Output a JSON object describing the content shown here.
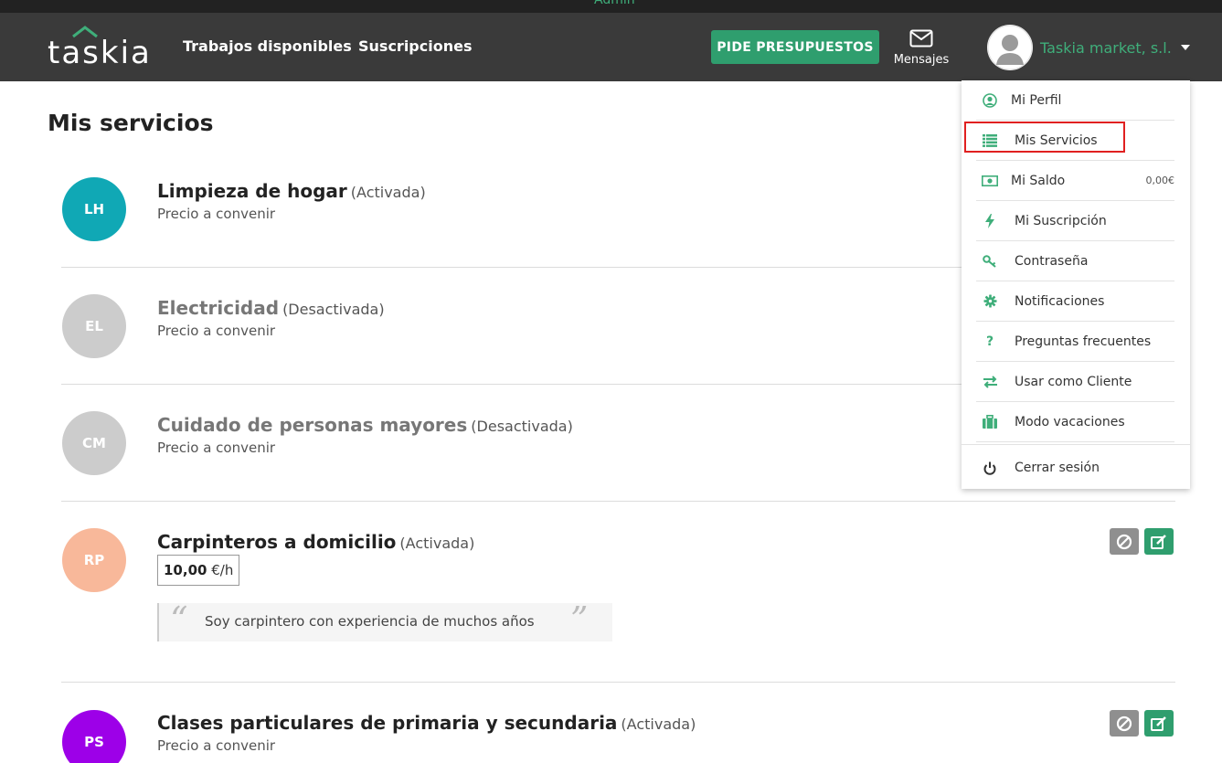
{
  "topbar": {
    "label": "Admin"
  },
  "brand": {
    "logo_text": "taskia",
    "accent": "#3fae7a"
  },
  "nav": {
    "links": [
      "Trabajos disponibles",
      "Suscripciones"
    ],
    "cta": "PIDE PRESUPUESTOS",
    "messages_label": "Mensajes",
    "user_name": "Taskia market, s.l."
  },
  "page": {
    "title": "Mis servicios"
  },
  "services": [
    {
      "initials": "LH",
      "title": "Limpieza de hogar",
      "status": "(Activada)",
      "price": "Precio a convenir",
      "color": "#10a8b5"
    },
    {
      "initials": "EL",
      "title": "Electricidad",
      "status": "(Desactivada)",
      "price": "Precio a convenir",
      "color": "#cccccc"
    },
    {
      "initials": "CM",
      "title": "Cuidado de personas mayores",
      "status": "(Desactivada)",
      "price": "Precio a convenir",
      "color": "#cccccc"
    },
    {
      "initials": "RP",
      "title": "Carpinteros a domicilio",
      "status": "(Activada)",
      "price_amount": "10,00",
      "price_unit": "€/h",
      "description": "Soy carpintero con experiencia de muchos años",
      "color": "#f8b89a"
    },
    {
      "initials": "PS",
      "title": "Clases particulares de primaria y secundaria",
      "status": "(Activada)",
      "price": "Precio a convenir",
      "color": "#9d00e8"
    }
  ],
  "menu": {
    "items": [
      {
        "label": "Mi Perfil",
        "icon": "user-circle-icon"
      },
      {
        "label": "Mis Servicios",
        "icon": "list-icon"
      },
      {
        "label": "Mi Saldo",
        "icon": "money-icon",
        "amount": "0,00€"
      },
      {
        "label": "Mi Suscripción",
        "icon": "bolt-icon"
      },
      {
        "label": "Contraseña",
        "icon": "key-icon"
      },
      {
        "label": "Notificaciones",
        "icon": "gear-icon"
      },
      {
        "label": "Preguntas frecuentes",
        "icon": "question-icon"
      },
      {
        "label": "Usar como Cliente",
        "icon": "exchange-icon"
      },
      {
        "label": "Modo vacaciones",
        "icon": "suitcase-icon"
      },
      {
        "label": "Cerrar sesión",
        "icon": "power-icon"
      }
    ]
  }
}
